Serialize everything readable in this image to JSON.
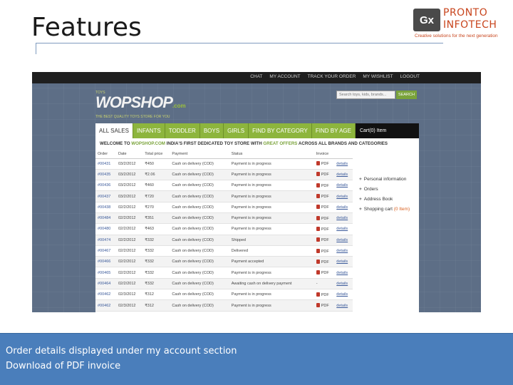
{
  "slide": {
    "title": "Features",
    "caption": [
      "Order details displayed under my account section",
      "Download of PDF invoice"
    ]
  },
  "logo": {
    "mark": "Gx",
    "name_line1": "PRONTO",
    "name_line2": "INFOTECH",
    "tagline": "Creative solutions for the next generation",
    "color": "#c8451d"
  },
  "site": {
    "top_nav": [
      "CHAT",
      "MY ACCOUNT",
      "TRACK YOUR ORDER",
      "MY WISHLIST",
      "LOGOUT"
    ],
    "brand_small": "TOYS",
    "brand_logo": "WOPSHOP",
    "brand_suffix": ".com",
    "brand_tagline": "THE BEST QUALITY TOYS STORE FOR YOU",
    "search_placeholder": "Search toys, kids, brands...",
    "search_button": "SEARCH",
    "tabs": [
      "ALL SALES",
      "INFANTS",
      "TODDLER",
      "BOYS",
      "GIRLS",
      "FIND BY CATEGORY",
      "FIND BY AGE"
    ],
    "cart_label": "Cart(0) Item",
    "welcome": {
      "prefix": "WELCOME TO ",
      "site": "WOPSHOP.COM",
      "middle": " INDIA'S FIRST DEDICATED TOY STORE WITH ",
      "offer": "GREAT OFFERS",
      "suffix": " ACROSS ALL BRANDS AND CATEGORIES"
    },
    "accent_color": "#8db53d"
  },
  "orders": {
    "columns": [
      "Order",
      "Date",
      "Total price",
      "Payment",
      "Status",
      "Invoice",
      ""
    ],
    "rows": [
      {
        "order": "#00431",
        "date": "03/2/2012",
        "total": "₹450",
        "payment": "Cash on delivery (COD)",
        "status": "Payment is in progress",
        "invoice": "PDF",
        "details": "details"
      },
      {
        "order": "#00435",
        "date": "03/2/2012",
        "total": "₹2.06",
        "payment": "Cash on delivery (COD)",
        "status": "Payment is in progress",
        "invoice": "PDF",
        "details": "details"
      },
      {
        "order": "#00436",
        "date": "03/2/2012",
        "total": "₹460",
        "payment": "Cash on delivery (COD)",
        "status": "Payment is in progress",
        "invoice": "PDF",
        "details": "details"
      },
      {
        "order": "#00437",
        "date": "03/2/2012",
        "total": "₹720",
        "payment": "Cash on delivery (COD)",
        "status": "Payment is in progress",
        "invoice": "PDF",
        "details": "details"
      },
      {
        "order": "#00438",
        "date": "02/2/2012",
        "total": "₹270",
        "payment": "Cash on delivery (COD)",
        "status": "Payment is in progress",
        "invoice": "PDF",
        "details": "details"
      },
      {
        "order": "#00484",
        "date": "02/2/2012",
        "total": "₹351",
        "payment": "Cash on delivery (COD)",
        "status": "Payment is in progress",
        "invoice": "PDF",
        "details": "details"
      },
      {
        "order": "#00480",
        "date": "02/2/2012",
        "total": "₹463",
        "payment": "Cash on delivery (COD)",
        "status": "Payment is in progress",
        "invoice": "PDF",
        "details": "details"
      },
      {
        "order": "#00474",
        "date": "02/2/2012",
        "total": "₹332",
        "payment": "Cash on delivery (COD)",
        "status": "Shipped",
        "invoice": "PDF",
        "details": "details"
      },
      {
        "order": "#00467",
        "date": "02/2/2012",
        "total": "₹332",
        "payment": "Cash on delivery (COD)",
        "status": "Delivered",
        "invoice": "PDF",
        "details": "details"
      },
      {
        "order": "#00466",
        "date": "02/2/2012",
        "total": "₹332",
        "payment": "Cash on delivery (COD)",
        "status": "Payment accepted",
        "invoice": "PDF",
        "details": "details"
      },
      {
        "order": "#00465",
        "date": "02/2/2012",
        "total": "₹332",
        "payment": "Cash on delivery (COD)",
        "status": "Payment is in progress",
        "invoice": "PDF",
        "details": "details"
      },
      {
        "order": "#00464",
        "date": "02/2/2012",
        "total": "₹332",
        "payment": "Cash on delivery (COD)",
        "status": "Awaiting cash on delivery payment",
        "invoice": "-",
        "details": "details"
      },
      {
        "order": "#00462",
        "date": "02/3/2012",
        "total": "₹312",
        "payment": "Cash on delivery (COD)",
        "status": "Payment is in progress",
        "invoice": "PDF",
        "details": "details"
      },
      {
        "order": "#00462",
        "date": "02/3/2012",
        "total": "₹312",
        "payment": "Cash on delivery (COD)",
        "status": "Payment is in progress",
        "invoice": "PDF",
        "details": "details"
      }
    ]
  },
  "account_menu": {
    "items": [
      {
        "label": "Personal information",
        "highlight": ""
      },
      {
        "label": "Orders",
        "highlight": ""
      },
      {
        "label": "Address Book",
        "highlight": ""
      },
      {
        "label": "Shopping cart ",
        "highlight": "(0 Item)"
      }
    ]
  },
  "caption_color": "#4a7ebb"
}
